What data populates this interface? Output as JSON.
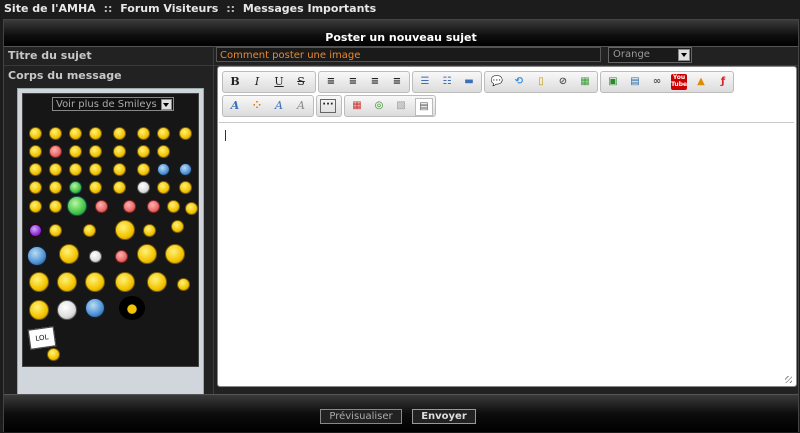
{
  "breadcrumb": {
    "site": "Site de l'AMHA",
    "sep1": "::",
    "forum": "Forum Visiteurs",
    "sep2": "::",
    "section": "Messages Importants"
  },
  "form": {
    "header": "Poster un nouveau sujet",
    "subject_label": "Titre du sujet",
    "subject_value": "Comment poster une image",
    "color_select": "Orange",
    "body_label": "Corps du message",
    "smileys_select": "Voir plus de Smileys"
  },
  "toolbar": {
    "bold": "B",
    "italic": "I",
    "underline": "U",
    "strike": "S",
    "youtube_line1": "You",
    "youtube_line2": "Tube"
  },
  "buttons": {
    "preview": "Prévisualiser",
    "submit": "Envoyer"
  },
  "icons": [
    "align-left-icon",
    "align-center-icon",
    "align-right-icon",
    "justify-icon",
    "bullet-list-icon",
    "numbered-list-icon",
    "horizontal-rule-icon",
    "quote-icon",
    "code-icon",
    "spoiler-icon",
    "hide-icon",
    "table-icon",
    "image-icon",
    "host-image-icon",
    "link-icon",
    "youtube-icon",
    "dailymotion-icon",
    "flash-icon",
    "font-color-icon",
    "color-picker-icon",
    "font-size-icon",
    "remove-format-icon",
    "more-icon",
    "date-icon",
    "search-icon",
    "paste-icon",
    "source-icon"
  ],
  "colors": {
    "accent": "#e8892e",
    "background": "#1c1c1c"
  }
}
